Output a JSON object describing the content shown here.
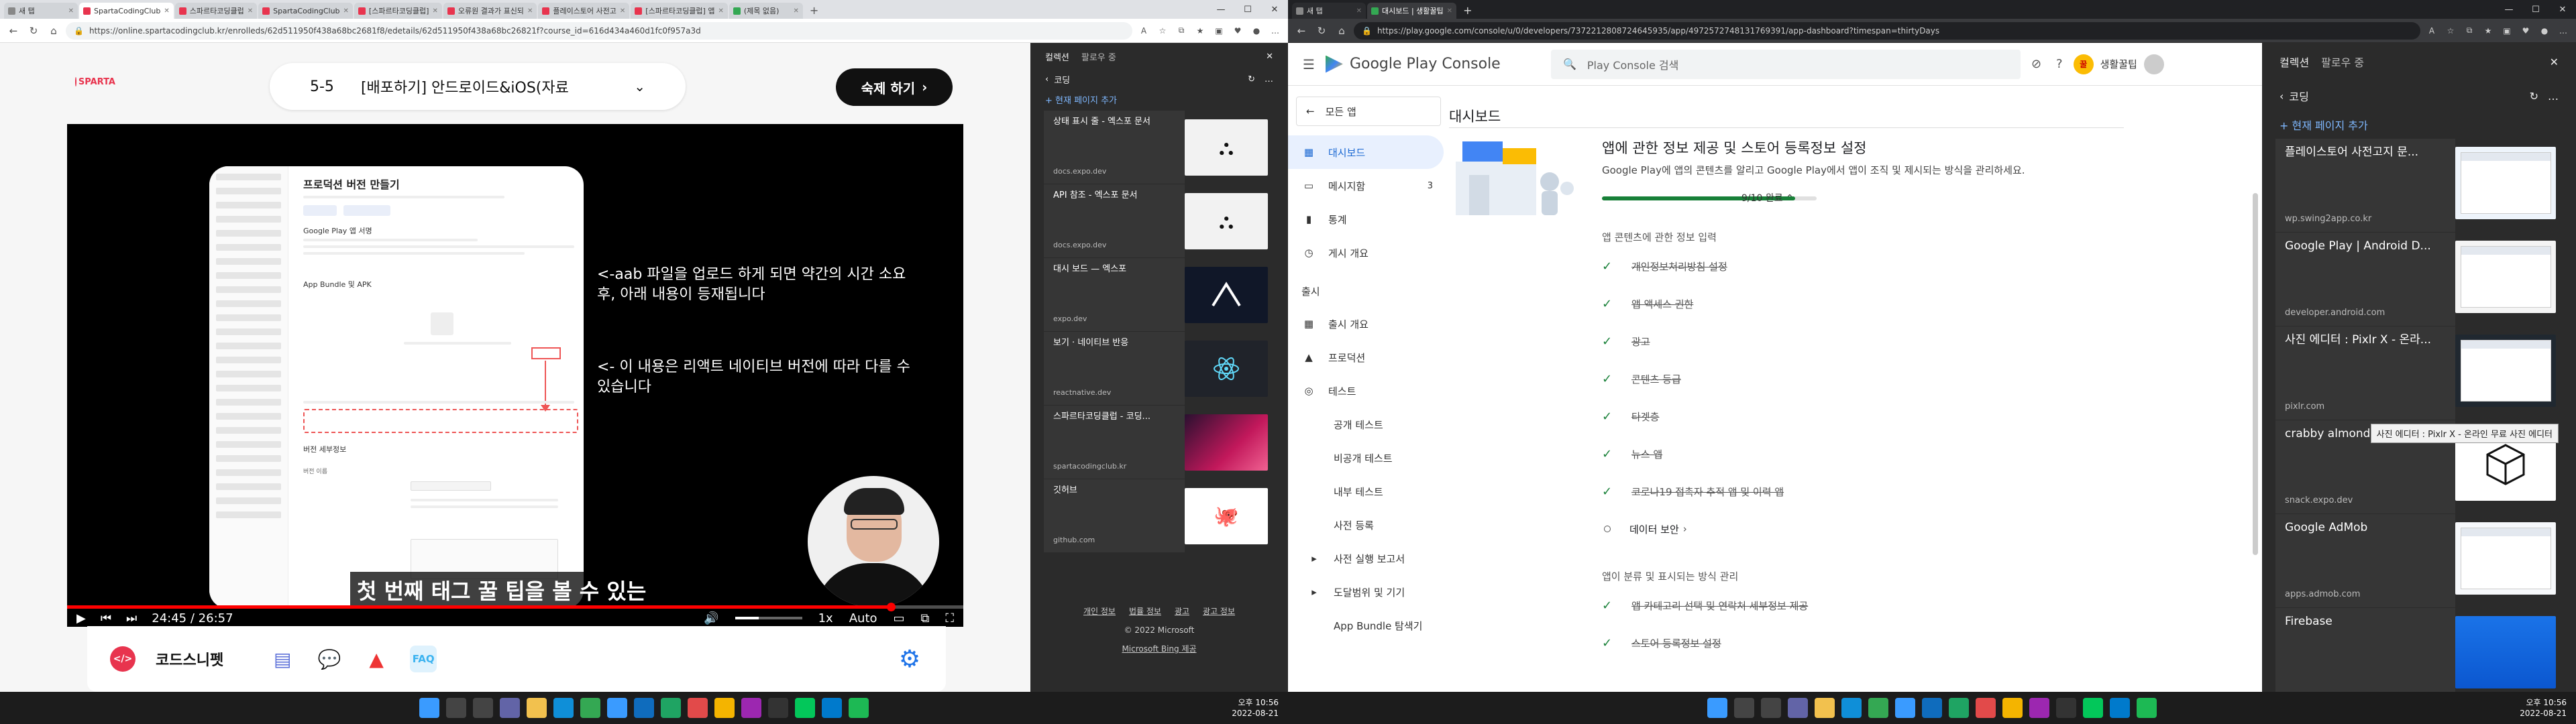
{
  "left": {
    "tabs": [
      {
        "label": "새 탭",
        "color": "#888888",
        "active": false
      },
      {
        "label": "SpartaCodingClub",
        "color": "#e8344e",
        "active": true
      },
      {
        "label": "스파르타코딩클럽",
        "color": "#e8344e",
        "active": false
      },
      {
        "label": "SpartaCodingClub",
        "color": "#e8344e",
        "active": false
      },
      {
        "label": "[스파르타코딩클럽]",
        "color": "#e8344e",
        "active": false
      },
      {
        "label": "오류원 결과가 표신되",
        "color": "#e8344e",
        "active": false
      },
      {
        "label": "플레이스토어 사전고",
        "color": "#e8344e",
        "active": false
      },
      {
        "label": "[스파르타코딩클럽] 앱",
        "color": "#e8344e",
        "active": false
      },
      {
        "label": "(제목 없음)",
        "color": "#34a853",
        "active": false
      }
    ],
    "url": "https://online.spartacodingclub.kr/enrolleds/62d511950f438a68bc2681f8/edetails/62d511950f438a68bc26821f?course_id=616d434a460d1fc0f957a3d",
    "sparta": {
      "logo": "SPARTA",
      "lesson_num": "5-5",
      "lesson_title": "[배포하기] 안드로이드&iOS(자료",
      "done_button": "숙제 하기",
      "slide": {
        "title": "프로덕션 버전 만들기",
        "app_label": "Google Play 앱 서명",
        "bundle_label": "App Bundle 및 APK",
        "detail_label": "버전 세부정보",
        "col_label": "버전 이름"
      },
      "note_upload": "<-aab 파일을 업로드 하게 되면 약간의 시간 소요 후, 아래 내용이 등재됩니다",
      "note_version": "<- 이 내용은 리액트 네이티브 버전에 따라 다를 수 있습니다",
      "subtitle": "첫 번째 태그 꿀 팁을 볼 수 있는",
      "time_current": "24:45",
      "time_sep": "/",
      "time_total": "26:57",
      "progress": 0.919,
      "volume": 0.35,
      "speed": "1x",
      "quality": "Auto",
      "brand": "코드스니펫",
      "faq": "FAQ"
    },
    "collections": {
      "tab_collections": "컬렉션",
      "tab_later": "팔로우 중",
      "folder": "코딩",
      "add_page": "+ 현재 페이지 추가",
      "items": [
        {
          "title": "상태 표시 줄 - 엑스포 문서",
          "src": "docs.expo.dev",
          "thumb": "expo-logo",
          "bg": "#f2f2f2"
        },
        {
          "title": "API 참조 - 엑스포 문서",
          "src": "docs.expo.dev",
          "thumb": "expo-logo",
          "bg": "#f2f2f2"
        },
        {
          "title": "대시 보드 — 엑스포",
          "src": "expo.dev",
          "thumb": "expo-chevron",
          "bg": "#101728"
        },
        {
          "title": "보기 · 네이티브 반응",
          "src": "reactnative.dev",
          "thumb": "react-logo",
          "bg": "#20232a"
        },
        {
          "title": "스파르타코딩클럽 - 코딩...",
          "src": "spartacodingclub.kr",
          "thumb": "sparta-gradient",
          "bg": "#2a1030"
        },
        {
          "title": "깃허브",
          "src": "github.com",
          "thumb": "octocat",
          "bg": "#ffffff"
        }
      ],
      "footer_links": [
        "개인 정보",
        "법률 정보",
        "광고",
        "광고 정보"
      ],
      "copyright": "© 2022 Microsoft",
      "bing": "Microsoft Bing 제공"
    },
    "clock_time": "오후 10:56",
    "clock_date": "2022-08-21"
  },
  "right": {
    "tabs": [
      {
        "label": "새 탭",
        "color": "#888888",
        "active": false
      },
      {
        "label": "대시보드 | 생활꿀팁",
        "color": "#34a853",
        "active": true
      }
    ],
    "url": "https://play.google.com/console/u/0/developers/7372212808724645935/app/4972572748131769391/app-dashboard?timespan=thirtyDays",
    "console": {
      "brand": "Google Play Console",
      "search_placeholder": "Play Console 검색",
      "app_name": "생활꿀팁",
      "all_apps": "모든 앱",
      "nav": [
        {
          "label": "대시보드",
          "icon": "dashboard-icon",
          "glyph": "▦",
          "selected": true,
          "count": ""
        },
        {
          "label": "메시지함",
          "icon": "inbox-icon",
          "glyph": "▭",
          "selected": false,
          "count": "3"
        },
        {
          "label": "통계",
          "icon": "stats-icon",
          "glyph": "▮",
          "selected": false,
          "count": ""
        },
        {
          "label": "게시 개요",
          "icon": "publish-icon",
          "glyph": "◷",
          "selected": false,
          "count": ""
        }
      ],
      "release_section": "출시",
      "release_nav": [
        {
          "label": "출시 개요",
          "icon": "release-overview-icon",
          "glyph": "▦",
          "sub": false
        },
        {
          "label": "프로덕션",
          "icon": "production-icon",
          "glyph": "▲",
          "sub": false
        },
        {
          "label": "테스트",
          "icon": "testing-icon",
          "glyph": "◎",
          "sub": false
        },
        {
          "label": "공개 테스트",
          "icon": "",
          "glyph": "",
          "sub": true
        },
        {
          "label": "비공개 테스트",
          "icon": "",
          "glyph": "",
          "sub": true
        },
        {
          "label": "내부 테스트",
          "icon": "",
          "glyph": "",
          "sub": true
        },
        {
          "label": "사전 등록",
          "icon": "",
          "glyph": "",
          "sub": true
        },
        {
          "label": "사전 실행 보고서",
          "icon": "expand-icon",
          "glyph": "▸",
          "sub": true
        },
        {
          "label": "도달범위 및 기기",
          "icon": "expand-icon",
          "glyph": "▸",
          "sub": true
        },
        {
          "label": "App Bundle 탐색기",
          "icon": "",
          "glyph": "",
          "sub": true
        }
      ],
      "page_title": "대시보드",
      "card_title": "앱에 관한 정보 제공 및 스토어 등록정보 설정",
      "card_desc": "Google Play에 앱의 콘텐츠를 알리고 Google Play에서 앱이 조직 및 제시되는 방식을 관리하세요.",
      "progress_text": "9/10 완료",
      "progress_value": 0.9,
      "group1": "앱 콘텐츠에 관한 정보 입력",
      "tasks1": [
        {
          "label": "개인정보처리방침 설정",
          "done": true
        },
        {
          "label": "앱 액세스 권한",
          "done": true
        },
        {
          "label": "광고",
          "done": true
        },
        {
          "label": "콘텐츠 등급",
          "done": true
        },
        {
          "label": "타겟층",
          "done": true
        },
        {
          "label": "뉴스 앱",
          "done": true
        },
        {
          "label": "코로나19 접촉자 추적 앱 및 이력 앱",
          "done": true
        },
        {
          "label": "데이터 보안",
          "done": false
        }
      ],
      "group2": "앱이 분류 및 표시되는 방식 관리",
      "tasks2": [
        {
          "label": "앱 카테고리 선택 및 연락처 세부정보 제공",
          "done": true
        },
        {
          "label": "스토어 등록정보 설정",
          "done": true
        }
      ]
    },
    "collections": {
      "tab_collections": "컬렉션",
      "tab_later": "팔로우 중",
      "folder": "코딩",
      "add_page": "+ 현재 페이지 추가",
      "items": [
        {
          "title": "플레이스토어 사전고지 문...",
          "src": "wp.swing2app.co.kr",
          "thumb": "doc-screenshot",
          "bg": "#eef4fb"
        },
        {
          "title": "Google Play | Android D...",
          "src": "developer.android.com",
          "thumb": "play-screenshot",
          "bg": "#f4f4f4"
        },
        {
          "title": "사진 에디터 : Pixlr X - 온라...",
          "src": "pixlr.com",
          "thumb": "pixlr-screenshot",
          "bg": "#202830"
        },
        {
          "title": "crabby almond - Snack",
          "src": "snack.expo.dev",
          "thumb": "snack-cube",
          "bg": "#ffffff"
        },
        {
          "title": "Google AdMob",
          "src": "apps.admob.com",
          "thumb": "admob-screenshot",
          "bg": "#f6f8fb"
        },
        {
          "title": "Firebase",
          "src": "",
          "thumb": "firebase-screenshot",
          "bg": "#1a73e8"
        }
      ],
      "tooltip": "사진 에디터 : Pixlr X - 온라인 무료 사진 에디터"
    },
    "clock_time": "오후 10:56",
    "clock_date": "2022-08-21"
  },
  "taskbar_icons": [
    {
      "name": "windows-start-icon",
      "color": "#3a9bff"
    },
    {
      "name": "search-icon",
      "color": "#444"
    },
    {
      "name": "task-view-icon",
      "color": "#444"
    },
    {
      "name": "chat-icon",
      "color": "#6264a7"
    },
    {
      "name": "file-explorer-icon",
      "color": "#f2c14e"
    },
    {
      "name": "edge-icon",
      "color": "#0f8fd8"
    },
    {
      "name": "chrome-icon",
      "color": "#34a853"
    },
    {
      "name": "store-icon",
      "color": "#3a9bff"
    },
    {
      "name": "mail-icon",
      "color": "#0f6cbd"
    },
    {
      "name": "photos-icon",
      "color": "#1fa463"
    },
    {
      "name": "notes-icon",
      "color": "#e24a4a"
    },
    {
      "name": "maps-icon",
      "color": "#f4b400"
    },
    {
      "name": "media-icon",
      "color": "#9c27b0"
    },
    {
      "name": "terminal-icon",
      "color": "#333"
    },
    {
      "name": "naver-icon",
      "color": "#03c75a"
    },
    {
      "name": "vscode-icon",
      "color": "#007acc"
    },
    {
      "name": "spotify-icon",
      "color": "#1db954"
    }
  ]
}
